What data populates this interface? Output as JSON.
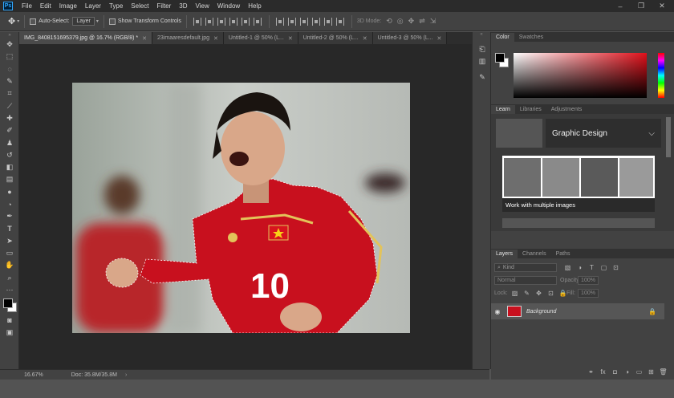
{
  "menubar": {
    "logo": "Ps",
    "items": [
      "File",
      "Edit",
      "Image",
      "Layer",
      "Type",
      "Select",
      "Filter",
      "3D",
      "View",
      "Window",
      "Help"
    ]
  },
  "window_controls": [
    "–",
    "❐",
    "✕"
  ],
  "options_bar": {
    "auto_select_label": "Auto-Select:",
    "auto_select_target": "Layer",
    "show_transform_label": "Show Transform Controls",
    "mode_3d_label": "3D Mode:"
  },
  "doc_tabs": [
    {
      "label": "IMG_8408151695379.jpg @ 16.7% (RGB/8) *",
      "active": true
    },
    {
      "label": "23imaaresdefault.jpg",
      "active": false
    },
    {
      "label": "Untitled-1 @ 50% (L...",
      "active": false
    },
    {
      "label": "Untitled-2 @ 50% (L...",
      "active": false
    },
    {
      "label": "Untitled-3 @ 50% (L...",
      "active": false
    }
  ],
  "status": {
    "zoom": "16.67%",
    "doc": "Doc: 35.8M/35.8M"
  },
  "color_panel": {
    "tabs": [
      "Color",
      "Swatches"
    ],
    "fg": "#000000",
    "bg": "#ffffff",
    "hue": "#e0101a"
  },
  "learn_panel": {
    "tabs": [
      "Learn",
      "Libraries",
      "Adjustments"
    ],
    "topic": "Graphic Design",
    "card_title": "Work with multiple images"
  },
  "layers_panel": {
    "tabs": [
      "Layers",
      "Channels",
      "Paths"
    ],
    "filter_placeholder": "Kind",
    "blend_mode": "Normal",
    "opacity_label": "Opacity:",
    "opacity_value": "100%",
    "lock_label": "Lock:",
    "fill_label": "Fill:",
    "fill_value": "100%",
    "layer_name": "Background"
  },
  "photo": {
    "jersey_number": "10",
    "jersey_color": "#c8101e"
  }
}
